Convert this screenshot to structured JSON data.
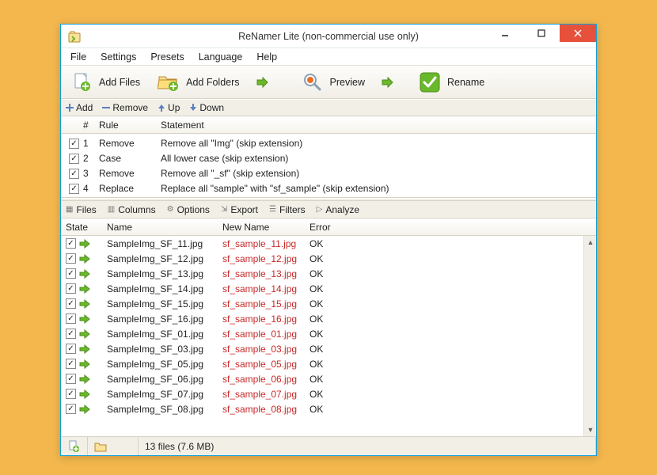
{
  "window": {
    "title": "ReNamer Lite (non-commercial use only)"
  },
  "menubar": [
    "File",
    "Settings",
    "Presets",
    "Language",
    "Help"
  ],
  "toolbar": {
    "addFiles": "Add Files",
    "addFolders": "Add Folders",
    "preview": "Preview",
    "rename": "Rename"
  },
  "rulesToolbar": {
    "add": "Add",
    "remove": "Remove",
    "up": "Up",
    "down": "Down"
  },
  "rulesHeader": {
    "num": "#",
    "rule": "Rule",
    "stmt": "Statement"
  },
  "rules": [
    {
      "n": "1",
      "rule": "Remove",
      "stmt": "Remove all \"Img\" (skip extension)"
    },
    {
      "n": "2",
      "rule": "Case",
      "stmt": "All lower case (skip extension)"
    },
    {
      "n": "3",
      "rule": "Remove",
      "stmt": "Remove all \"_sf\" (skip extension)"
    },
    {
      "n": "4",
      "rule": "Replace",
      "stmt": "Replace all \"sample\" with \"sf_sample\" (skip extension)"
    }
  ],
  "filesToolbar": [
    "Files",
    "Columns",
    "Options",
    "Export",
    "Filters",
    "Analyze"
  ],
  "filesHeader": {
    "state": "State",
    "name": "Name",
    "newname": "New Name",
    "error": "Error"
  },
  "files": [
    {
      "name": "SampleImg_SF_11.jpg",
      "new": "sf_sample_11.jpg",
      "err": "OK"
    },
    {
      "name": "SampleImg_SF_12.jpg",
      "new": "sf_sample_12.jpg",
      "err": "OK"
    },
    {
      "name": "SampleImg_SF_13.jpg",
      "new": "sf_sample_13.jpg",
      "err": "OK"
    },
    {
      "name": "SampleImg_SF_14.jpg",
      "new": "sf_sample_14.jpg",
      "err": "OK"
    },
    {
      "name": "SampleImg_SF_15.jpg",
      "new": "sf_sample_15.jpg",
      "err": "OK"
    },
    {
      "name": "SampleImg_SF_16.jpg",
      "new": "sf_sample_16.jpg",
      "err": "OK"
    },
    {
      "name": "SampleImg_SF_01.jpg",
      "new": "sf_sample_01.jpg",
      "err": "OK"
    },
    {
      "name": "SampleImg_SF_03.jpg",
      "new": "sf_sample_03.jpg",
      "err": "OK"
    },
    {
      "name": "SampleImg_SF_05.jpg",
      "new": "sf_sample_05.jpg",
      "err": "OK"
    },
    {
      "name": "SampleImg_SF_06.jpg",
      "new": "sf_sample_06.jpg",
      "err": "OK"
    },
    {
      "name": "SampleImg_SF_07.jpg",
      "new": "sf_sample_07.jpg",
      "err": "OK"
    },
    {
      "name": "SampleImg_SF_08.jpg",
      "new": "sf_sample_08.jpg",
      "err": "OK"
    }
  ],
  "statusbar": {
    "summary": "13 files (7.6 MB)"
  }
}
